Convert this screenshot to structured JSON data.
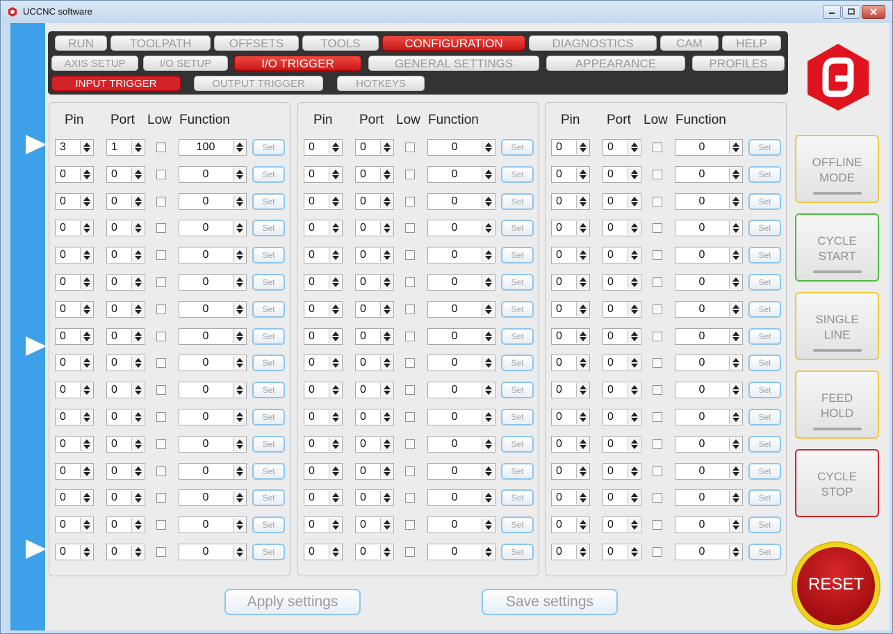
{
  "window": {
    "title": "UCCNC software"
  },
  "main_tabs": [
    "RUN",
    "TOOLPATH",
    "OFFSETS",
    "TOOLS",
    "CONFIGURATION",
    "DIAGNOSTICS",
    "CAM",
    "HELP"
  ],
  "config_tabs": [
    "AXIS SETUP",
    "I/O SETUP",
    "I/O TRIGGER",
    "GENERAL SETTINGS",
    "APPEARANCE",
    "PROFILES"
  ],
  "trigger_tabs": [
    "INPUT TRIGGER",
    "OUTPUT TRIGGER",
    "HOTKEYS"
  ],
  "active": {
    "main": "CONFIGURATION",
    "config": "I/O TRIGGER",
    "trigger": "INPUT TRIGGER"
  },
  "columns": {
    "pin": "Pin",
    "port": "Port",
    "low": "Low",
    "function": "Function"
  },
  "set_label": "Set",
  "panels": [
    {
      "rows": [
        [
          "3",
          "1",
          false,
          "100"
        ],
        [
          "0",
          "0",
          false,
          "0"
        ],
        [
          "0",
          "0",
          false,
          "0"
        ],
        [
          "0",
          "0",
          false,
          "0"
        ],
        [
          "0",
          "0",
          false,
          "0"
        ],
        [
          "0",
          "0",
          false,
          "0"
        ],
        [
          "0",
          "0",
          false,
          "0"
        ],
        [
          "0",
          "0",
          false,
          "0"
        ],
        [
          "0",
          "0",
          false,
          "0"
        ],
        [
          "0",
          "0",
          false,
          "0"
        ],
        [
          "0",
          "0",
          false,
          "0"
        ],
        [
          "0",
          "0",
          false,
          "0"
        ],
        [
          "0",
          "0",
          false,
          "0"
        ],
        [
          "0",
          "0",
          false,
          "0"
        ],
        [
          "0",
          "0",
          false,
          "0"
        ],
        [
          "0",
          "0",
          false,
          "0"
        ]
      ]
    },
    {
      "rows": [
        [
          "0",
          "0",
          false,
          "0"
        ],
        [
          "0",
          "0",
          false,
          "0"
        ],
        [
          "0",
          "0",
          false,
          "0"
        ],
        [
          "0",
          "0",
          false,
          "0"
        ],
        [
          "0",
          "0",
          false,
          "0"
        ],
        [
          "0",
          "0",
          false,
          "0"
        ],
        [
          "0",
          "0",
          false,
          "0"
        ],
        [
          "0",
          "0",
          false,
          "0"
        ],
        [
          "0",
          "0",
          false,
          "0"
        ],
        [
          "0",
          "0",
          false,
          "0"
        ],
        [
          "0",
          "0",
          false,
          "0"
        ],
        [
          "0",
          "0",
          false,
          "0"
        ],
        [
          "0",
          "0",
          false,
          "0"
        ],
        [
          "0",
          "0",
          false,
          "0"
        ],
        [
          "0",
          "0",
          false,
          "0"
        ],
        [
          "0",
          "0",
          false,
          "0"
        ]
      ]
    },
    {
      "rows": [
        [
          "0",
          "0",
          false,
          "0"
        ],
        [
          "0",
          "0",
          false,
          "0"
        ],
        [
          "0",
          "0",
          false,
          "0"
        ],
        [
          "0",
          "0",
          false,
          "0"
        ],
        [
          "0",
          "0",
          false,
          "0"
        ],
        [
          "0",
          "0",
          false,
          "0"
        ],
        [
          "0",
          "0",
          false,
          "0"
        ],
        [
          "0",
          "0",
          false,
          "0"
        ],
        [
          "0",
          "0",
          false,
          "0"
        ],
        [
          "0",
          "0",
          false,
          "0"
        ],
        [
          "0",
          "0",
          false,
          "0"
        ],
        [
          "0",
          "0",
          false,
          "0"
        ],
        [
          "0",
          "0",
          false,
          "0"
        ],
        [
          "0",
          "0",
          false,
          "0"
        ],
        [
          "0",
          "0",
          false,
          "0"
        ],
        [
          "0",
          "0",
          false,
          "0"
        ]
      ]
    }
  ],
  "actions": {
    "apply": "Apply settings",
    "save": "Save settings"
  },
  "side_buttons": [
    {
      "line1": "OFFLINE",
      "line2": "MODE",
      "color": "#f0c93a"
    },
    {
      "line1": "CYCLE",
      "line2": "START",
      "color": "#4cbf3c"
    },
    {
      "line1": "SINGLE",
      "line2": "LINE",
      "color": "#f0c93a"
    },
    {
      "line1": "FEED",
      "line2": "HOLD",
      "color": "#f0c93a"
    },
    {
      "line1": "CYCLE",
      "line2": "STOP",
      "color": "#d3232a"
    }
  ],
  "reset_label": "RESET",
  "colors": {
    "accent_red": "#d3232a",
    "left_bar": "#3ea0e8",
    "menu_bg": "#333333"
  }
}
